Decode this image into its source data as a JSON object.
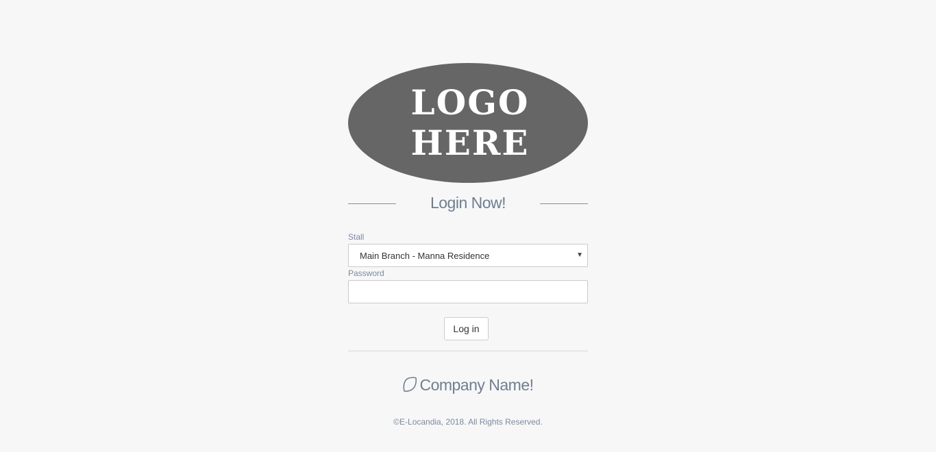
{
  "logo": {
    "line1": "LOGO",
    "line2": "HERE",
    "background_color": "#666666",
    "text_color": "#ffffff"
  },
  "heading": "Login Now!",
  "form": {
    "stall_label": "Stall",
    "stall_selected": "Main Branch - Manna Residence",
    "password_label": "Password",
    "password_value": "",
    "login_button": "Log in"
  },
  "footer": {
    "company_name": "Company Name!",
    "company_icon": "leaf-icon",
    "copyright": "©E-Locandia, 2018. All Rights Reserved."
  },
  "colors": {
    "page_background": "#f7f7f7",
    "accent_text": "#6f7e92"
  }
}
